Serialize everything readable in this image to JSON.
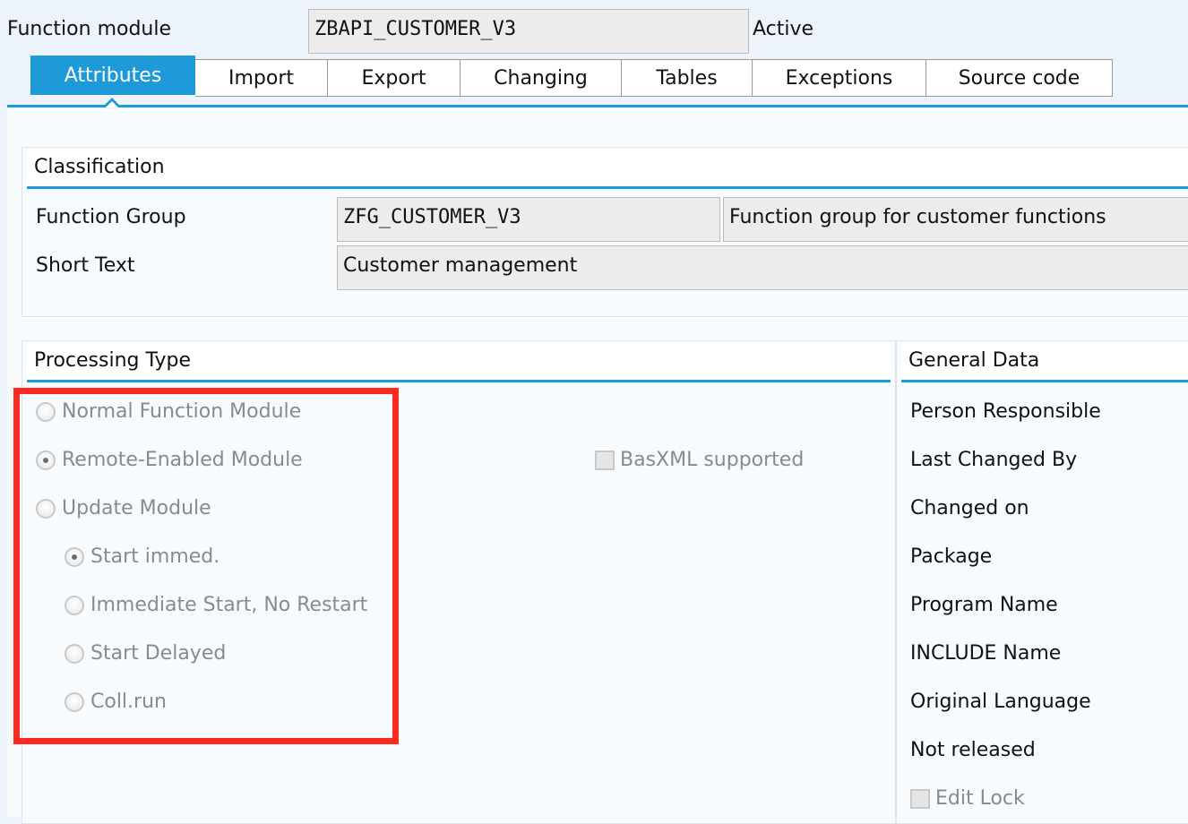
{
  "header": {
    "object_label": "Function module",
    "object_name": "ZBAPI_CUSTOMER_V3",
    "status": "Active"
  },
  "tabs": [
    {
      "label": "Attributes",
      "active": true
    },
    {
      "label": "Import"
    },
    {
      "label": "Export"
    },
    {
      "label": "Changing"
    },
    {
      "label": "Tables"
    },
    {
      "label": "Exceptions"
    },
    {
      "label": "Source code"
    }
  ],
  "classification": {
    "title": "Classification",
    "function_group_label": "Function Group",
    "function_group_value": "ZFG_CUSTOMER_V3",
    "function_group_desc": "Function group for customer functions",
    "short_text_label": "Short Text",
    "short_text_value": "Customer management"
  },
  "processing_type": {
    "title": "Processing Type",
    "options": [
      {
        "label": "Normal Function Module",
        "selected": false
      },
      {
        "label": "Remote-Enabled Module",
        "selected": true
      },
      {
        "label": "Update Module",
        "selected": false
      }
    ],
    "update_options": [
      {
        "label": "Start immed.",
        "selected": true
      },
      {
        "label": "Immediate Start, No Restart",
        "selected": false
      },
      {
        "label": "Start Delayed",
        "selected": false
      },
      {
        "label": "Coll.run",
        "selected": false
      }
    ],
    "basxml_label": "BasXML supported"
  },
  "general_data": {
    "title": "General Data",
    "fields": [
      "Person Responsible",
      "Last Changed By",
      "Changed on",
      "Package",
      "Program Name",
      "INCLUDE Name",
      "Original Language",
      "Not released"
    ],
    "edit_lock_label": "Edit Lock"
  },
  "colors": {
    "accent": "#1e9ad8",
    "highlight": "#ff2a1f"
  }
}
